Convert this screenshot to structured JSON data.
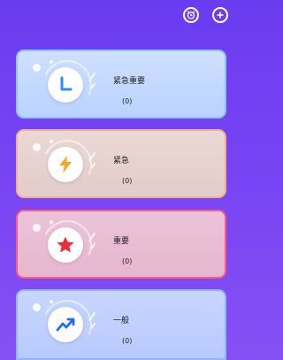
{
  "toolbar": {
    "alarm_icon": "alarm-clock-icon",
    "add_icon": "plus-icon"
  },
  "categories": [
    {
      "title": "紧急重要",
      "count": "(0)",
      "icon": "clock-icon",
      "icon_color": "#2f8cff"
    },
    {
      "title": "紧急",
      "count": "(0)",
      "icon": "lightning-icon",
      "icon_color": "#f5a623"
    },
    {
      "title": "重要",
      "count": "(0)",
      "icon": "star-icon",
      "icon_color": "#ef2b3a"
    },
    {
      "title": "一般",
      "count": "(0)",
      "icon": "trend-up-icon",
      "icon_color": "#1e6cff"
    }
  ]
}
